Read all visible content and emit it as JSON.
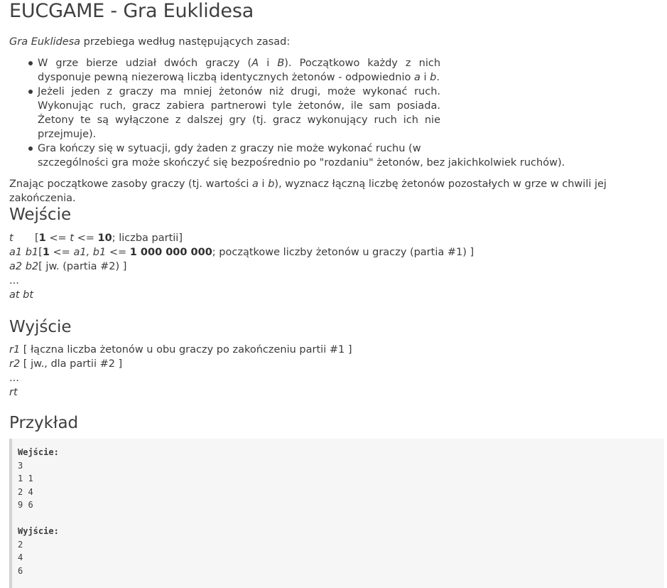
{
  "title": "EUCGAME - Gra Euklidesa",
  "intro": {
    "italic": "Gra Euklidesa",
    "rest": " przebiega według następujących zasad:"
  },
  "rules": [
    {
      "parts": [
        "W grze bierze udział dwóch graczy (",
        "A",
        " i ",
        "B",
        "). Początkowo każdy z nich dysponuje pewną niezerową liczbą identycznych żetonów - odpowiednio ",
        "a",
        " i ",
        "b",
        "."
      ]
    },
    {
      "text": "Jeżeli jeden z graczy ma mniej żetonów niż drugi, może wykonać ruch. Wykonując ruch, gracz zabiera partnerowi tyle żetonów, ile sam posiada. Żetony te są wyłączone z dalszej gry (tj. gracz wykonujący ruch ich nie przejmuje)."
    },
    {
      "line1": "Gra kończy się w sytuacji, gdy żaden z graczy nie może wykonać ruchu (w",
      "line2": "szczególności gra może skończyć się bezpośrednio po \"rozdaniu\" żetonów, bez jakichkolwiek ruchów)."
    }
  ],
  "summary": {
    "pre": "Znając początkowe zasoby graczy (tj. wartości ",
    "a": "a",
    "mid": " i ",
    "b": "b",
    "post": "), wyznacz łączną liczbę żetonów pozostałych w grze w chwili jej zakończenia."
  },
  "input_heading": "Wejście",
  "input": {
    "r1": {
      "var": "t",
      "open": "[",
      "n1": "1",
      "le1": " <= ",
      "v": "t",
      "le2": " <= ",
      "n2": "10",
      "rest": "; liczba partii]"
    },
    "r2": {
      "var": "a1 b1",
      "open": "[",
      "n1": "1",
      "le1": " <= ",
      "v": "a1, b1",
      "le2": " <= ",
      "n2": "1 000 000 000",
      "rest": "; początkowe liczby żetonów u graczy (partia #1) ]"
    },
    "r3": {
      "var": "a2 b2",
      "rest": "[ jw. (partia #2) ]"
    },
    "r4": "...",
    "r5": "at bt"
  },
  "output_heading": "Wyjście",
  "output": {
    "r1": {
      "var": "r1",
      "rest": " [ łączna liczba żetonów u obu graczy po zakończeniu partii #1 ]"
    },
    "r2": {
      "var": "r2",
      "rest": " [ jw., dla partii #2 ]"
    },
    "r3": "...",
    "r4": "rt"
  },
  "example_heading": "Przykład",
  "example": {
    "in_label": "Wejście:",
    "in_lines": [
      "3",
      "1 1",
      "2 4",
      "9 6"
    ],
    "out_label": "Wyjście:",
    "out_lines": [
      "2",
      "4",
      "6"
    ]
  }
}
